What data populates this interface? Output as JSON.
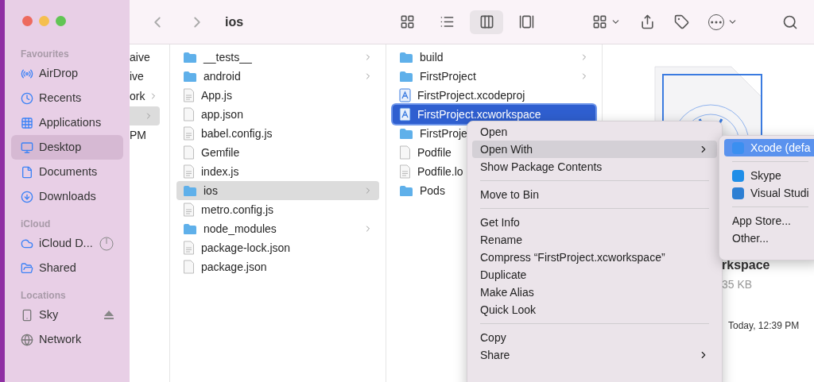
{
  "window": {
    "title": "ios"
  },
  "sidebar": {
    "sections": [
      {
        "heading": "Favourites",
        "items": [
          {
            "kind": "airdrop",
            "label": "AirDrop",
            "selected": false
          },
          {
            "kind": "recents",
            "label": "Recents",
            "selected": false
          },
          {
            "kind": "applications",
            "label": "Applications",
            "selected": false
          },
          {
            "kind": "desktop",
            "label": "Desktop",
            "selected": true
          },
          {
            "kind": "documents",
            "label": "Documents",
            "selected": false
          },
          {
            "kind": "downloads",
            "label": "Downloads",
            "selected": false
          }
        ]
      },
      {
        "heading": "iCloud",
        "items": [
          {
            "kind": "icloud",
            "label": "iCloud D...",
            "selected": false
          },
          {
            "kind": "shared",
            "label": "Shared",
            "selected": false
          }
        ]
      },
      {
        "heading": "Locations",
        "items": [
          {
            "kind": "device",
            "label": "Sky",
            "selected": false
          },
          {
            "kind": "network",
            "label": "Network",
            "selected": false
          }
        ]
      }
    ]
  },
  "toolbar": {
    "view_modes": [
      {
        "kind": "icons",
        "selected": false
      },
      {
        "kind": "list",
        "selected": false
      },
      {
        "kind": "columns",
        "selected": true
      },
      {
        "kind": "gallery",
        "selected": false
      }
    ]
  },
  "columns": [
    {
      "items": [
        {
          "label": "aive",
          "selected": false,
          "expandable": false
        },
        {
          "label": "ive",
          "selected": false,
          "expandable": false
        },
        {
          "label": "ork",
          "selected": false,
          "expandable": true
        },
        {
          "selected": true,
          "expandable": true
        },
        {
          "label": "PM",
          "selected": false,
          "expandable": false
        }
      ]
    },
    {
      "items": [
        {
          "label": "__tests__",
          "kind": "folder",
          "selected": false,
          "expandable": true
        },
        {
          "label": "android",
          "kind": "folder",
          "selected": false,
          "expandable": true
        },
        {
          "label": "App.js",
          "kind": "js",
          "selected": false,
          "expandable": false
        },
        {
          "label": "app.json",
          "kind": "file",
          "selected": false,
          "expandable": false
        },
        {
          "label": "babel.config.js",
          "kind": "js",
          "selected": false,
          "expandable": false
        },
        {
          "label": "Gemfile",
          "kind": "file",
          "selected": false,
          "expandable": false
        },
        {
          "label": "index.js",
          "kind": "js",
          "selected": false,
          "expandable": false
        },
        {
          "label": "ios",
          "kind": "folder",
          "selected": true,
          "expandable": true
        },
        {
          "label": "metro.config.js",
          "kind": "js",
          "selected": false,
          "expandable": false
        },
        {
          "label": "node_modules",
          "kind": "folder",
          "selected": false,
          "expandable": true
        },
        {
          "label": "package-lock.json",
          "kind": "text",
          "selected": false,
          "expandable": false
        },
        {
          "label": "package.json",
          "kind": "file",
          "selected": false,
          "expandable": false
        }
      ]
    },
    {
      "items": [
        {
          "label": "build",
          "kind": "folder",
          "selected": false,
          "expandable": true
        },
        {
          "label": "FirstProject",
          "kind": "folder",
          "selected": false,
          "expandable": true
        },
        {
          "label": "FirstProject.xcodeproj",
          "kind": "xcode",
          "selected": false,
          "expandable": false
        },
        {
          "label": "FirstProject.xcworkspace",
          "kind": "xcode",
          "selected": true,
          "expandable": false
        },
        {
          "label": "FirstProje",
          "kind": "folder",
          "selected": false,
          "expandable": false
        },
        {
          "label": "Podfile",
          "kind": "file",
          "selected": false,
          "expandable": false
        },
        {
          "label": "Podfile.lo",
          "kind": "text",
          "selected": false,
          "expandable": false
        },
        {
          "label": "Pods",
          "kind": "folder",
          "selected": false,
          "expandable": false
        }
      ]
    }
  ],
  "preview": {
    "name": "rkspace",
    "size": "35 KB",
    "date": "Today, 12:39 PM"
  },
  "context_menu": {
    "groups": [
      [
        {
          "label": "Open",
          "selected": false,
          "submenu": false
        },
        {
          "label": "Open With",
          "selected": true,
          "submenu": true
        },
        {
          "label": "Show Package Contents",
          "selected": false,
          "submenu": false
        }
      ],
      [
        {
          "label": "Move to Bin",
          "selected": false,
          "submenu": false
        }
      ],
      [
        {
          "label": "Get Info",
          "selected": false,
          "submenu": false
        },
        {
          "label": "Rename",
          "selected": false,
          "submenu": false
        },
        {
          "label": "Compress “FirstProject.xcworkspace”",
          "selected": false,
          "submenu": false
        },
        {
          "label": "Duplicate",
          "selected": false,
          "submenu": false
        },
        {
          "label": "Make Alias",
          "selected": false,
          "submenu": false
        },
        {
          "label": "Quick Look",
          "selected": false,
          "submenu": false
        }
      ],
      [
        {
          "label": "Copy",
          "selected": false,
          "submenu": false
        },
        {
          "label": "Share",
          "selected": false,
          "submenu": true
        }
      ]
    ]
  },
  "submenu": {
    "groups": [
      [
        {
          "label": "Xcode (defa",
          "kind": "xcode",
          "selected": true
        }
      ],
      [
        {
          "label": "Skype",
          "kind": "skype",
          "selected": false
        },
        {
          "label": "Visual Studi",
          "kind": "vscode",
          "selected": false
        }
      ],
      [
        {
          "label": "App Store...",
          "kind": "none",
          "selected": false
        },
        {
          "label": "Other...",
          "kind": "none",
          "selected": false
        }
      ]
    ]
  }
}
